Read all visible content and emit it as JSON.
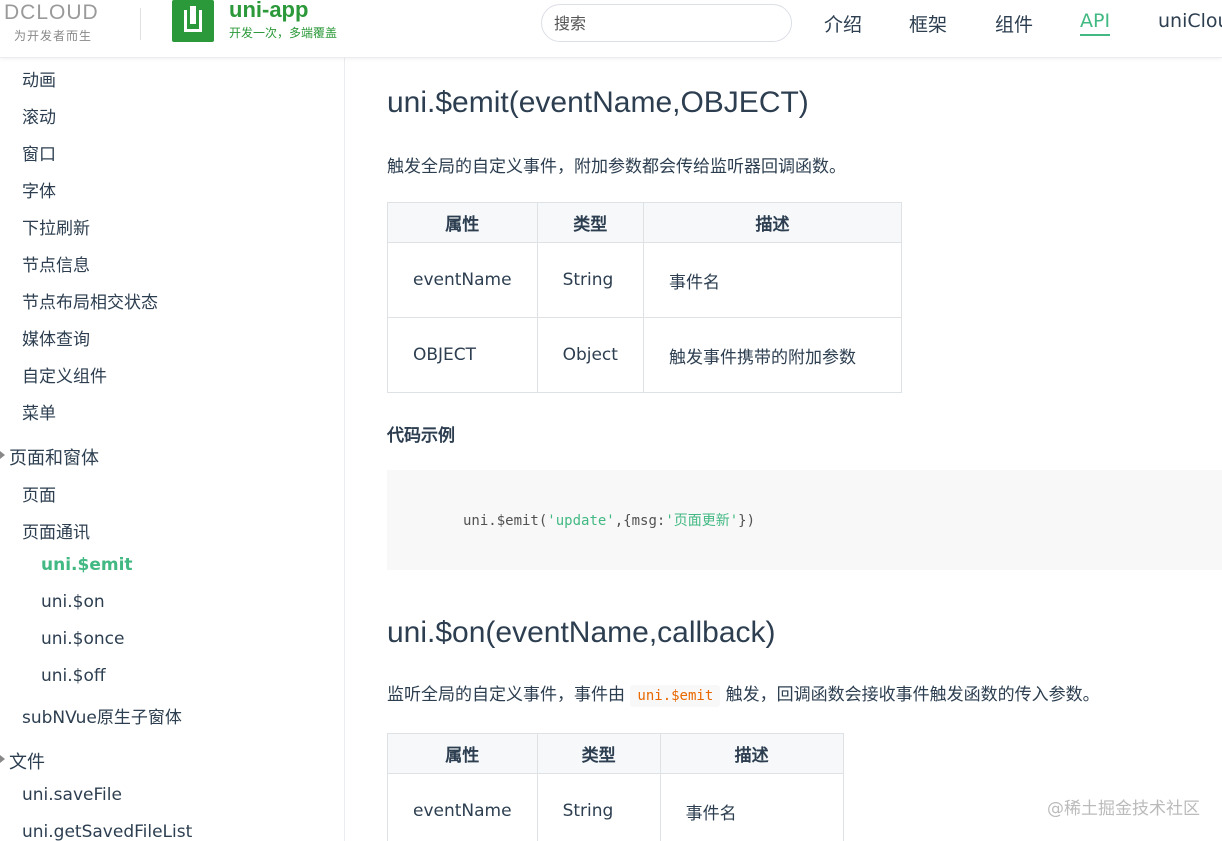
{
  "header": {
    "dcloud_logo": "DCLOUD",
    "dcloud_slogan": "为开发者而生",
    "uni_logo": "uni-app",
    "uni_slogan": "开发一次，多端覆盖",
    "search_placeholder": "搜索",
    "nav": [
      "介绍",
      "框架",
      "组件",
      "API",
      "uniClou"
    ],
    "active_nav": "API"
  },
  "sidebar": {
    "items_top": [
      "动画",
      "滚动",
      "窗口",
      "字体",
      "下拉刷新",
      "节点信息",
      "节点布局相交状态",
      "媒体查询",
      "自定义组件",
      "菜单"
    ],
    "group_window": "页面和窗体",
    "window_items": [
      "页面",
      "页面通讯"
    ],
    "comm_items": [
      "uni.$emit",
      "uni.$on",
      "uni.$once",
      "uni.$off"
    ],
    "subnvue": "subNVue原生子窗体",
    "group_file": "文件",
    "file_items": [
      "uni.saveFile",
      "uni.getSavedFileList"
    ],
    "active_item": "uni.$emit"
  },
  "content": {
    "emit": {
      "title": "uni.$emit(eventName,OBJECT)",
      "desc": "触发全局的自定义事件，附加参数都会传给监听器回调函数。",
      "table_headers": [
        "属性",
        "类型",
        "描述"
      ],
      "rows": [
        [
          "eventName",
          "String",
          "事件名"
        ],
        [
          "OBJECT",
          "Object",
          "触发事件携带的附加参数"
        ]
      ],
      "example_heading": "代码示例",
      "code": {
        "prefix": "uni.$emit(",
        "arg1": "'update'",
        "mid": ",{msg:",
        "arg2": "'页面更新'",
        "suffix": "})"
      }
    },
    "on": {
      "title": "uni.$on(eventName,callback)",
      "desc_before": "监听全局的自定义事件，事件由",
      "desc_code": "uni.$emit",
      "desc_after": "触发，回调函数会接收事件触发函数的传入参数。",
      "table_headers": [
        "属性",
        "类型",
        "描述"
      ],
      "rows": [
        [
          "eventName",
          "String",
          "事件名"
        ]
      ]
    }
  },
  "watermark": "@稀土掘金技术社区",
  "colors": {
    "accent": "#42b983",
    "brand_green": "#2b9939",
    "text": "#2c3e50",
    "code_string": "#42b983",
    "inline_code": "#e96900"
  }
}
